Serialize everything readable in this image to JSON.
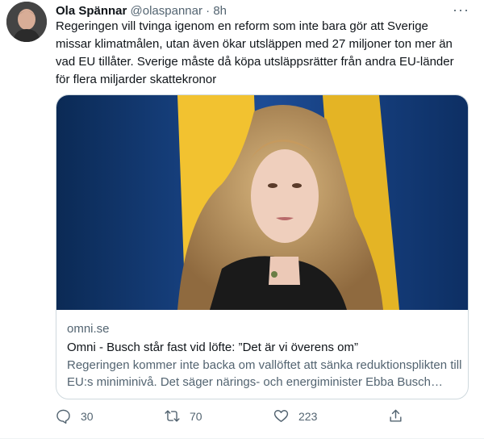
{
  "tweet": {
    "author_name": "Ola Spännar",
    "author_handle": "@olaspannar",
    "separator": "·",
    "time": "8h",
    "more": "···",
    "text": "Regeringen vill tvinga igenom en reform som inte bara gör att Sverige missar klimatmålen, utan även ökar utsläppen med 27 miljoner ton mer än vad EU tillåter. Sverige måste då köpa utsläppsrätter från andra EU-länder för flera miljarder skattekronor"
  },
  "card": {
    "domain": "omni.se",
    "title": "Omni - Busch står fast vid löfte: ”Det är vi överens om”",
    "description": "Regeringen kommer inte backa om vallöftet att sänka reduktionsplikten till EU:s miniminivå. Det säger närings- och energiminister Ebba Busch…"
  },
  "actions": {
    "replies": "30",
    "retweets": "70",
    "likes": "223"
  },
  "colors": {
    "text_primary": "#0f1419",
    "text_secondary": "#536471",
    "border": "#cfd9de",
    "flag_blue": "#1f4e9a",
    "flag_yellow": "#f2c230"
  }
}
